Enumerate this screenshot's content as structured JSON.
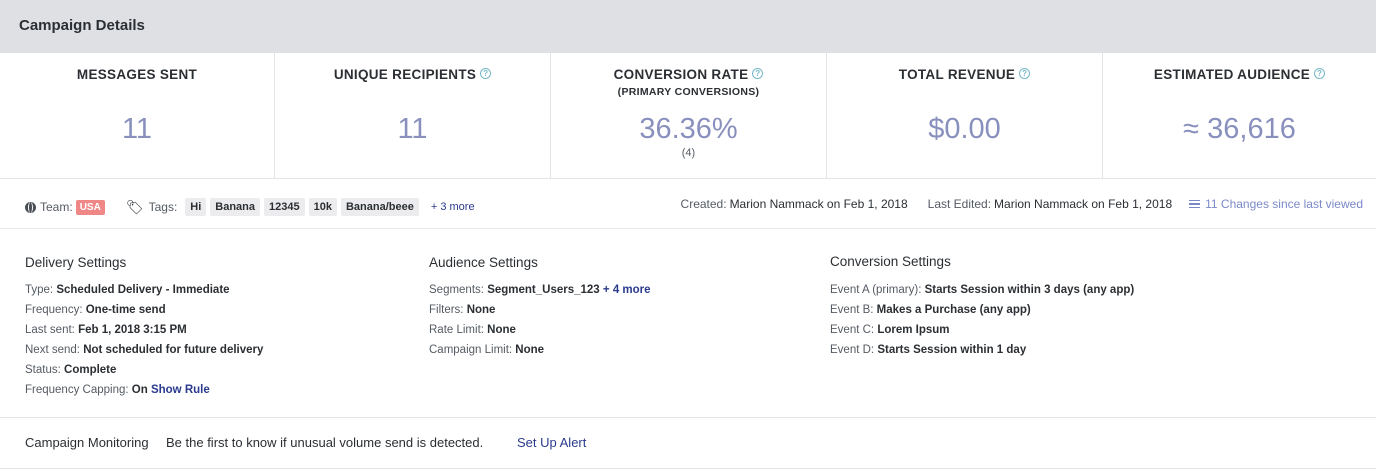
{
  "header": {
    "title": "Campaign Details"
  },
  "stats": [
    {
      "label": "MESSAGES SENT",
      "sub": "",
      "value": "11",
      "note": "",
      "help": false
    },
    {
      "label": "UNIQUE RECIPIENTS",
      "sub": "",
      "value": "11",
      "note": "",
      "help": true
    },
    {
      "label": "CONVERSION RATE",
      "sub": "(PRIMARY CONVERSIONS)",
      "value": "36.36%",
      "note": "(4)",
      "help": true
    },
    {
      "label": "TOTAL REVENUE",
      "sub": "",
      "value": "$0.00",
      "note": "",
      "help": true
    },
    {
      "label": "ESTIMATED AUDIENCE",
      "sub": "",
      "value": "≈ 36,616",
      "note": "",
      "help": true
    }
  ],
  "meta": {
    "team_label": "Team:",
    "team_badge": "USA",
    "tags_label": "Tags:",
    "tags": [
      "Hi",
      "Banana",
      "12345",
      "10k",
      "Banana/beee"
    ],
    "tags_more": "+ 3 more",
    "created_label": "Created:",
    "created_value": "Marion Nammack on Feb 1, 2018",
    "edited_label": "Last Edited:",
    "edited_value": "Marion Nammack on Feb 1, 2018",
    "changes_link": "11 Changes since last viewed"
  },
  "delivery": {
    "title": "Delivery Settings",
    "rows": [
      {
        "k": "Type:",
        "v": "Scheduled Delivery - Immediate"
      },
      {
        "k": "Frequency:",
        "v": "One-time send"
      },
      {
        "k": "Last sent:",
        "v": "Feb 1, 2018 3:15 PM"
      },
      {
        "k": "Next send:",
        "v": "Not scheduled for future delivery"
      },
      {
        "k": "Status:",
        "v": "Complete"
      },
      {
        "k": "Frequency Capping:",
        "v": "On",
        "link": "Show Rule"
      }
    ]
  },
  "audience": {
    "title": "Audience Settings",
    "rows": [
      {
        "k": "Segments:",
        "v": "Segment_Users_123",
        "link": "+ 4 more"
      },
      {
        "k": "Filters:",
        "v": "None"
      },
      {
        "k": "Rate Limit:",
        "v": "None"
      },
      {
        "k": "Campaign Limit:",
        "v": "None"
      }
    ]
  },
  "conversion": {
    "title": "Conversion Settings",
    "rows": [
      {
        "k": "Event A (primary):",
        "v": "Starts Session within 3 days (any app)"
      },
      {
        "k": "Event B:",
        "v": "Makes a Purchase (any app)"
      },
      {
        "k": "Event C:",
        "v": "Lorem Ipsum"
      },
      {
        "k": "Event D:",
        "v": "Starts Session within 1 day"
      }
    ]
  },
  "monitoring": {
    "title": "Campaign Monitoring",
    "text": "Be the first to know if unusual volume send is detected.",
    "link": "Set Up Alert"
  }
}
